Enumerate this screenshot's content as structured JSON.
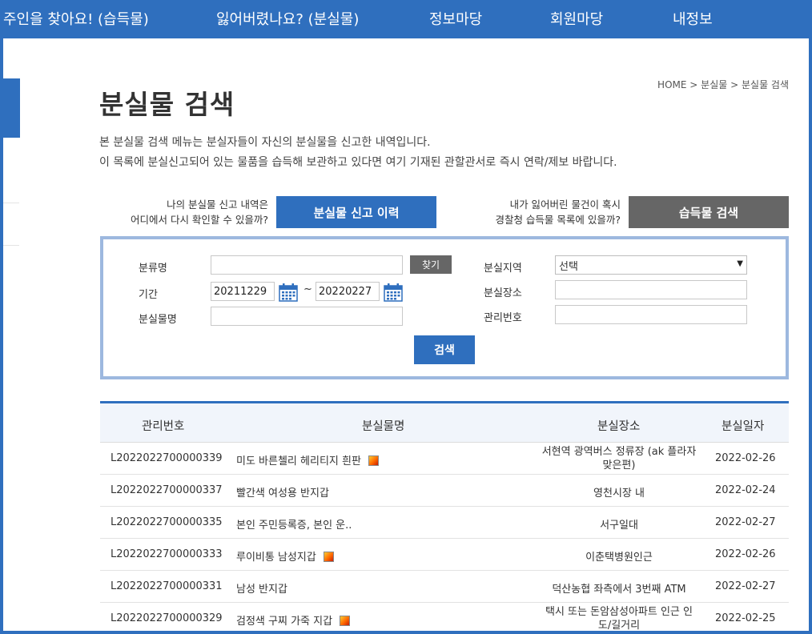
{
  "nav": {
    "items": [
      "주인을 찾아요! (습득물)",
      "잃어버렸나요? (분실물)",
      "정보마당",
      "회원마당",
      "내정보"
    ]
  },
  "breadcrumb": [
    "HOME",
    "분실물",
    "분실물 검색"
  ],
  "page": {
    "title": "분실물 검색",
    "desc1": "본 분실물 검색 메뉴는 분실자들이 자신의 분실물을 신고한 내역입니다.",
    "desc2": "이 목록에 분실신고되어 있는 물품을 습득해 보관하고 있다면 여기 기재된 관할관서로 즉시 연락/제보 바랍니다."
  },
  "promo": {
    "left_line1": "나의 분실물 신고 내역은",
    "left_line2": "어디에서 다시 확인할 수 있을까?",
    "left_button": "분실물 신고 이력",
    "right_line1": "내가 잃어버린 물건이 혹시",
    "right_line2": "경찰청 습득물 목록에 있을까?",
    "right_button": "습득물 검색"
  },
  "search": {
    "category_label": "분류명",
    "category_value": "",
    "find_label": "찾기",
    "period_label": "기간",
    "date_from": "20211229",
    "tilde": "~",
    "date_to": "20220227",
    "item_label": "분실물명",
    "item_value": "",
    "region_label": "분실지역",
    "region_value": "선택",
    "place_label": "분실장소",
    "place_value": "",
    "manage_label": "관리번호",
    "manage_value": "",
    "search_button": "검색"
  },
  "table": {
    "headers": [
      "관리번호",
      "분실물명",
      "분실장소",
      "분실일자"
    ],
    "rows": [
      {
        "id": "L2022022700000339",
        "name": "미도 바른첼리 헤리티지 흰판",
        "place1": "서현역 광역버스 정류장 (ak 플라자",
        "place2": "맞은편)",
        "date": "2022-02-26",
        "image": true
      },
      {
        "id": "L2022022700000337",
        "name": "빨간색 여성용 반지갑",
        "place1": "영천시장 내",
        "place2": "",
        "date": "2022-02-24",
        "image": false
      },
      {
        "id": "L2022022700000335",
        "name": "본인 주민등록증, 본인 운..",
        "place1": "서구일대",
        "place2": "",
        "date": "2022-02-27",
        "image": false
      },
      {
        "id": "L2022022700000333",
        "name": "루이비통 남성지갑",
        "place1": "이춘택병원인근",
        "place2": "",
        "date": "2022-02-26",
        "image": true
      },
      {
        "id": "L2022022700000331",
        "name": "남성 반지갑",
        "place1": "덕산농협 좌측에서 3번째 ATM",
        "place2": "",
        "date": "2022-02-27",
        "image": false
      },
      {
        "id": "L2022022700000329",
        "name": "검정색 구찌 가죽 지갑",
        "place1": "택시 또는 돈암삼성아파트 인근 인",
        "place2": "도/길거리",
        "date": "2022-02-25",
        "image": true
      }
    ]
  },
  "colors": {
    "brand": "#2f6fbe",
    "gray_button": "#666666",
    "search_border": "#9db8df"
  },
  "icons": [
    "calendar-icon",
    "image-icon",
    "chevron-down-icon"
  ]
}
